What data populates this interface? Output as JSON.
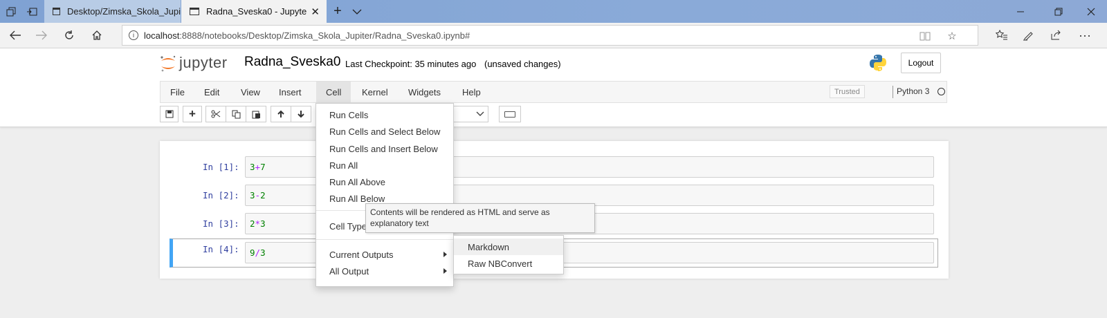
{
  "browser": {
    "tabs": [
      {
        "title": "Desktop/Zimska_Skola_Jupi",
        "active": false
      },
      {
        "title": "Radna_Sveska0 - Jupyte",
        "active": true
      }
    ],
    "url_host": "localhost",
    "url_path": ":8888/notebooks/Desktop/Zimska_Skola_Jupiter/Radna_Sveska0.ipynb#",
    "icons": [
      "tab-manager-icon",
      "set-aside-tabs-icon",
      "new-tab-icon",
      "tab-list-icon",
      "back-icon",
      "forward-icon",
      "refresh-icon",
      "home-icon",
      "reading-view-icon",
      "favorite-star-icon",
      "favorites-icon",
      "notes-icon",
      "share-icon",
      "more-icon",
      "minimize-icon",
      "maximize-icon",
      "close-icon"
    ]
  },
  "header": {
    "logo_text": "jupyter",
    "notebook_name": "Radna_Sveska0",
    "checkpoint": "Last Checkpoint: 35 minutes ago",
    "status": "(unsaved changes)",
    "logout": "Logout"
  },
  "menu": {
    "items": [
      "File",
      "Edit",
      "View",
      "Insert",
      "Cell",
      "Kernel",
      "Widgets",
      "Help"
    ],
    "open": "Cell",
    "trusted": "Trusted",
    "kernel": "Python 3"
  },
  "cells": [
    {
      "prompt": "In [1]:",
      "tokens": [
        {
          "t": "3",
          "c": "num"
        },
        {
          "t": "+",
          "c": "op"
        },
        {
          "t": "7",
          "c": "num"
        }
      ]
    },
    {
      "prompt": "In [2]:",
      "tokens": [
        {
          "t": "3",
          "c": "num"
        },
        {
          "t": "-",
          "c": "op"
        },
        {
          "t": "2",
          "c": "num"
        }
      ]
    },
    {
      "prompt": "In [3]:",
      "tokens": [
        {
          "t": "2",
          "c": "num"
        },
        {
          "t": "*",
          "c": "op"
        },
        {
          "t": "3",
          "c": "num"
        }
      ]
    },
    {
      "prompt": "In [4]:",
      "tokens": [
        {
          "t": "9",
          "c": "num"
        },
        {
          "t": "/",
          "c": "op"
        },
        {
          "t": "3",
          "c": "num"
        }
      ]
    }
  ],
  "selected_cell": 4,
  "cell_menu": {
    "items": [
      "Run Cells",
      "Run Cells and Select Below",
      "Run Cells and Insert Below",
      "Run All",
      "Run All Above",
      "Run All Below",
      "Cell Type",
      "Current Outputs",
      "All Output"
    ]
  },
  "cell_type_submenu": {
    "items": [
      "Markdown",
      "Raw NBConvert"
    ],
    "hovered": "Markdown"
  },
  "tooltip": "Contents will be rendered as HTML and serve as explanatory text",
  "colors": {
    "selected_cell_bar": "#42a5f5",
    "prompt": "#303f9f",
    "number": "#008000",
    "operator": "#aa22ff"
  }
}
